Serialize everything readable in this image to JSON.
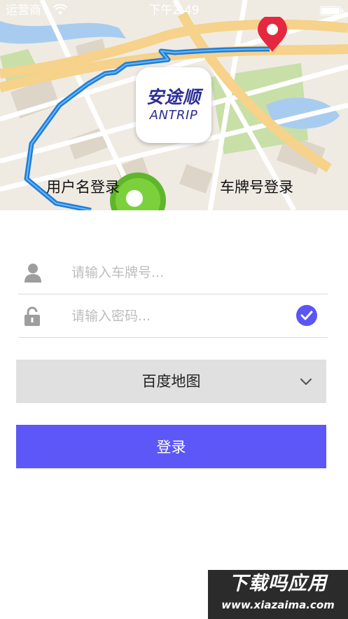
{
  "status_bar": {
    "carrier": "运营商",
    "time": "下午2:49"
  },
  "logo": {
    "name_cn": "安途顺",
    "name_en": "ANTRIP"
  },
  "tabs": {
    "username_login": "用户名登录",
    "plate_login": "车牌号登录"
  },
  "form": {
    "plate_placeholder": "请输入车牌号...",
    "password_placeholder": "请输入密码...",
    "map_provider": "百度地图",
    "login_label": "登录"
  },
  "watermark": {
    "title": "下载吗应用",
    "url": "www.xiazaima.com"
  },
  "colors": {
    "accent": "#5e57f7",
    "select_bg": "#e0e0e0",
    "route": "#1e7fd8",
    "pin": "#e5283f"
  }
}
